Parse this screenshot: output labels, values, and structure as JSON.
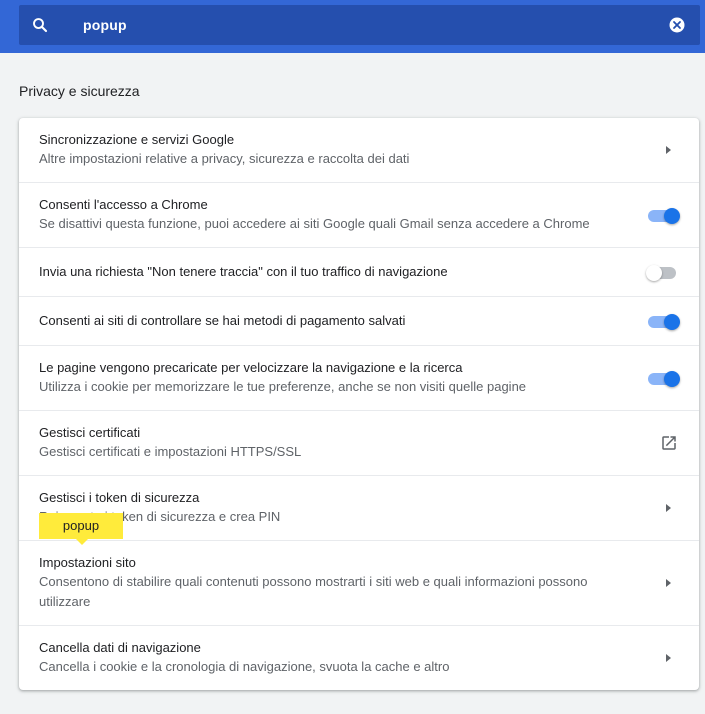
{
  "search": {
    "value": "popup",
    "icon": "search-icon",
    "clear_icon": "close-circle-icon"
  },
  "section": {
    "title": "Privacy e sicurezza"
  },
  "rows": [
    {
      "title": "Sincronizzazione e servizi Google",
      "subtitle": "Altre impostazioni relative a privacy, sicurezza e raccolta dei dati",
      "control": "chevron"
    },
    {
      "title": "Consenti l'accesso a Chrome",
      "subtitle": "Se disattivi questa funzione, puoi accedere ai siti Google quali Gmail senza accedere a Chrome",
      "control": "toggle",
      "enabled": true
    },
    {
      "title": "Invia una richiesta \"Non tenere traccia\" con il tuo traffico di navigazione",
      "control": "toggle",
      "enabled": false
    },
    {
      "title": "Consenti ai siti di controllare se hai metodi di pagamento salvati",
      "control": "toggle",
      "enabled": true
    },
    {
      "title": "Le pagine vengono precaricate per velocizzare la navigazione e la ricerca",
      "subtitle": "Utilizza i cookie per memorizzare le tue preferenze, anche se non visiti quelle pagine",
      "control": "toggle",
      "enabled": true
    },
    {
      "title": "Gestisci certificati",
      "subtitle": "Gestisci certificati e impostazioni HTTPS/SSL",
      "control": "external-link"
    },
    {
      "title": "Gestisci i token di sicurezza",
      "subtitle": "Reimposta i token di sicurezza e crea PIN",
      "control": "chevron"
    },
    {
      "title": "Impostazioni sito",
      "subtitle": "Consentono di stabilire quali contenuti possono mostrarti i siti web e quali informazioni possono utilizzare",
      "control": "chevron"
    },
    {
      "title": "Cancella dati di navigazione",
      "subtitle": "Cancella i cookie e la cronologia di navigazione, svuota la cache e altro",
      "control": "chevron"
    }
  ],
  "popup": {
    "label": "popup",
    "color": "#ffeb3b"
  },
  "colors": {
    "header": "#3367d6",
    "search_box": "#254fae",
    "toggle_on": "#1a73e8",
    "toggle_track_on": "#8ab4f8"
  }
}
